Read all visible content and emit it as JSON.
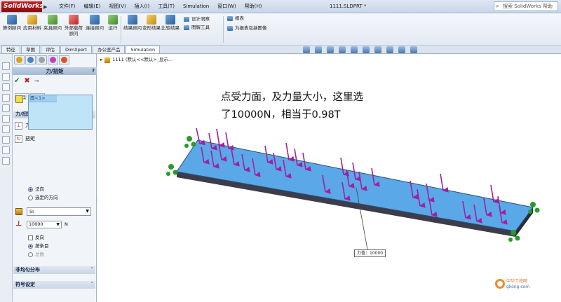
{
  "app": {
    "logo": "SolidWorks",
    "doc_title": "1111.SLDPRT *",
    "search_placeholder": "搜索 SolidWorks 帮助",
    "menu": [
      "文件(F)",
      "编辑(E)",
      "视图(V)",
      "插入(I)",
      "工具(T)",
      "Simulation",
      "窗口(W)",
      "帮助(H)"
    ]
  },
  "commandbar": {
    "tools": [
      {
        "label": "算例顾问",
        "icon": "study-advisor-icon",
        "color": "b"
      },
      {
        "label": "应用材料",
        "icon": "apply-material-icon",
        "color": "y"
      },
      {
        "label": "夹具顾问",
        "icon": "fixture-advisor-icon",
        "color": "g"
      },
      {
        "label": "外部载荷顾问",
        "icon": "external-loads-icon",
        "color": "r"
      },
      {
        "label": "连接顾问",
        "icon": "connections-advisor-icon",
        "color": "b"
      },
      {
        "label": "运行",
        "icon": "run-icon",
        "color": "g"
      },
      {
        "label": "结果顾问",
        "icon": "results-advisor-icon",
        "color": "b"
      },
      {
        "label": "变形结果",
        "icon": "deformed-result-icon",
        "color": "y"
      },
      {
        "label": "比较结果",
        "icon": "compare-results-icon",
        "color": "b"
      }
    ],
    "design_study": "设计洞察",
    "plot_tools": "图解工具",
    "report": "报表",
    "include_image": "为报表包括图像"
  },
  "tabs": [
    "特征",
    "草图",
    "评估",
    "DimXpert",
    "办公室产品",
    "Simulation"
  ],
  "active_tab": "Simulation",
  "property_manager": {
    "title": "力/扭矩",
    "help": "?",
    "subtabs": [
      "类型",
      "分割"
    ],
    "section_force_torque": "力/扭矩",
    "option_force": "力",
    "option_torque": "扭矩",
    "face_item": "面<1>",
    "radio_normal": "法向",
    "radio_selected_dir": "选定的方向",
    "units": "SI",
    "force_value": "10000",
    "force_unit": "N",
    "check_reverse": "反向",
    "radio_per_item": "按条目",
    "radio_total": "总数",
    "section_nonuniform": "非均匀分布",
    "section_symbol": "符号设定"
  },
  "graphics": {
    "tree_node": "1111 (默认<<默认>_显示...",
    "annotation_line1": "点受力面，及力量大小，这里选",
    "annotation_line2": "了10000N，相当于0.98T",
    "callout": "力值：10000",
    "watermark_line1": "中华工控网",
    "watermark_line2": "gkong.com"
  }
}
